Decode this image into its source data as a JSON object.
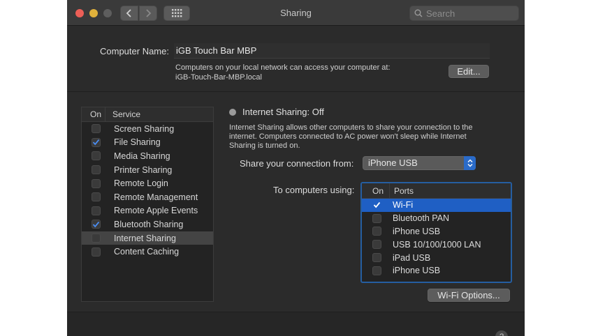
{
  "window": {
    "title": "Sharing",
    "search_placeholder": "Search"
  },
  "computer_name": {
    "label": "Computer Name:",
    "value": "iGB Touch Bar MBP",
    "note_line1": "Computers on your local network can access your computer at:",
    "note_line2": "iGB-Touch-Bar-MBP.local",
    "edit_label": "Edit..."
  },
  "services": {
    "header_on": "On",
    "header_service": "Service",
    "items": [
      {
        "label": "Screen Sharing",
        "on": false,
        "selected": false
      },
      {
        "label": "File Sharing",
        "on": true,
        "selected": false
      },
      {
        "label": "Media Sharing",
        "on": false,
        "selected": false
      },
      {
        "label": "Printer Sharing",
        "on": false,
        "selected": false
      },
      {
        "label": "Remote Login",
        "on": false,
        "selected": false
      },
      {
        "label": "Remote Management",
        "on": false,
        "selected": false
      },
      {
        "label": "Remote Apple Events",
        "on": false,
        "selected": false
      },
      {
        "label": "Bluetooth Sharing",
        "on": true,
        "selected": false
      },
      {
        "label": "Internet Sharing",
        "on": false,
        "selected": true
      },
      {
        "label": "Content Caching",
        "on": false,
        "selected": false
      }
    ]
  },
  "internet_sharing": {
    "status": "Internet Sharing: Off",
    "desc_line1": "Internet Sharing allows other computers to share your connection to the",
    "desc_line2": "internet. Computers connected to AC power won't sleep while Internet",
    "desc_line3": "Sharing is turned on.",
    "share_from_label": "Share your connection from:",
    "share_from_value": "iPhone USB",
    "to_label": "To computers using:",
    "ports_header_on": "On",
    "ports_header_ports": "Ports",
    "ports": [
      {
        "label": "Wi-Fi",
        "on": true,
        "selected": true
      },
      {
        "label": "Bluetooth PAN",
        "on": false,
        "selected": false
      },
      {
        "label": "iPhone USB",
        "on": false,
        "selected": false
      },
      {
        "label": "USB 10/100/1000 LAN",
        "on": false,
        "selected": false
      },
      {
        "label": "iPad USB",
        "on": false,
        "selected": false
      },
      {
        "label": "iPhone USB",
        "on": false,
        "selected": false
      }
    ],
    "wifi_options_label": "Wi-Fi Options..."
  },
  "help": "?",
  "colors": {
    "accent": "#1f5fc4",
    "checkbox_check": "#4a8cf0",
    "window_bg": "#2b2b2b"
  }
}
